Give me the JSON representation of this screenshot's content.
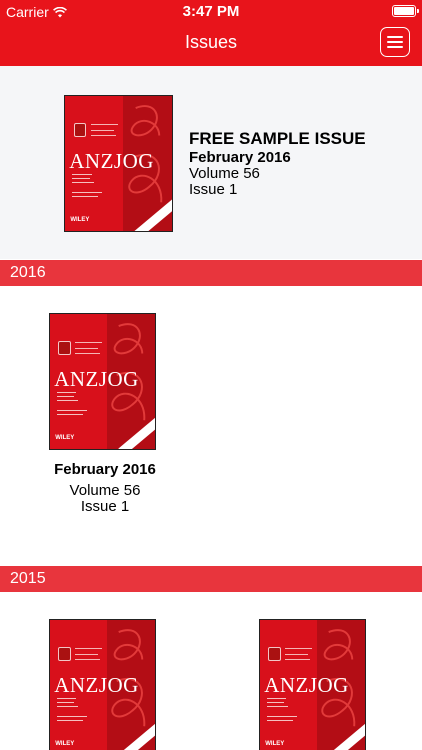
{
  "status": {
    "carrier": "Carrier",
    "time": "3:47 PM"
  },
  "nav": {
    "title": "Issues"
  },
  "featured": {
    "heading": "FREE SAMPLE ISSUE",
    "date": "February 2016",
    "volume": "Volume 56",
    "issue": "Issue 1",
    "cover_brand": "ANZJOG",
    "cover_publisher": "WILEY"
  },
  "sections": [
    {
      "year": "2016",
      "issues": [
        {
          "date": "February 2016",
          "volume": "Volume 56",
          "issue": "Issue 1",
          "cover_brand": "ANZJOG",
          "cover_publisher": "WILEY"
        }
      ]
    },
    {
      "year": "2015",
      "issues": [
        {
          "cover_brand": "ANZJOG",
          "cover_publisher": "WILEY"
        },
        {
          "cover_brand": "ANZJOG",
          "cover_publisher": "WILEY"
        }
      ]
    }
  ],
  "colors": {
    "brand_red": "#e8141b",
    "section_red": "#e8353d",
    "featured_bg": "#f5f6f8"
  }
}
